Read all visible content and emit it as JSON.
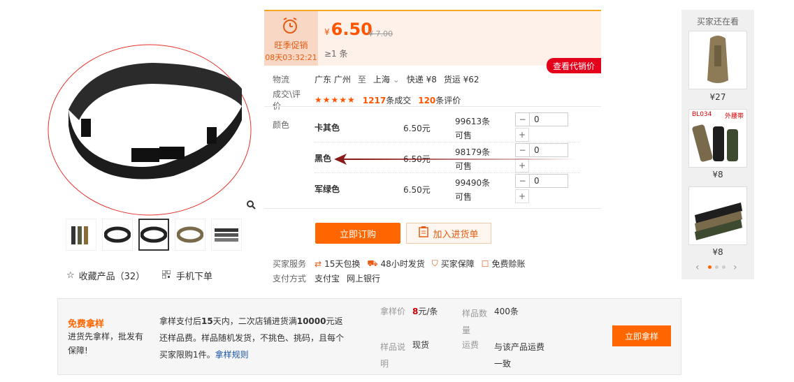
{
  "gallery": {
    "thumbnails": [
      "belt-bundle",
      "belt-black-1",
      "belt-black-2",
      "belt-khaki",
      "belt-set"
    ],
    "favorite_label": "收藏产品（32）",
    "mobile_label": "手机下单"
  },
  "pricebox": {
    "promo_label": "旺季促销",
    "countdown": "08天03:32:21",
    "currency": "¥",
    "price": "6.50",
    "old_price": "¥ 7.00",
    "min_qty": "≥1 条",
    "agent_button": "查看代销价"
  },
  "logistics": {
    "label": "物流",
    "from": "广东 广州",
    "to_word": "至",
    "to": "上海",
    "express": "快递 ¥8",
    "freight": "货运 ¥62"
  },
  "deals": {
    "label": "成交\\评价",
    "stars": "★★★★★",
    "deals_count": "1217",
    "deals_unit": "条成交",
    "reviews_count": "120",
    "reviews_unit": "条评价"
  },
  "colors": {
    "label": "颜色",
    "rows": [
      {
        "name": "卡其色",
        "price": "6.50元",
        "stock": "99613条可售",
        "qty": "0"
      },
      {
        "name": "黑色",
        "price": "6.50元",
        "stock": "98179条可售",
        "qty": "0"
      },
      {
        "name": "军绿色",
        "price": "6.50元",
        "stock": "99490条可售",
        "qty": "0"
      }
    ]
  },
  "actions": {
    "order": "立即订购",
    "cart": "加入进货单"
  },
  "services": {
    "label": "买家服务",
    "items": [
      "15天包换",
      "48小时发货",
      "买家保障",
      "免费赊账"
    ],
    "pay_label": "支付方式",
    "pay_items": [
      "支付宝",
      "网上银行"
    ]
  },
  "sidebar": {
    "title": "买家还在看",
    "items": [
      {
        "price": "¥27",
        "tag": ""
      },
      {
        "price": "¥8",
        "tag": "BL034"
      },
      {
        "price": "¥8",
        "tag": ""
      }
    ],
    "tag_extra": "外腰带"
  },
  "sample": {
    "title": "免费拿样",
    "subtitle": "进货先拿样，批发有保障!",
    "desc_1": "拿样支付后",
    "desc_days": "15",
    "desc_2": "天内，二次店铺进货满",
    "desc_amount": "10000",
    "desc_3": "元返还样品费。样品随机发货，不挑色、挑码，且每个买家限购1件。",
    "rule_link": "拿样规则",
    "price_label": "拿样价",
    "price_value": "8",
    "price_unit": "元/条",
    "qty_label": "样品数量",
    "qty_value": "400条",
    "note_label": "样品说明",
    "note_value": "现货",
    "ship_label": "运费",
    "ship_value": "与该产品运费一致",
    "button": "立即拿样"
  },
  "accent": "#ff5500"
}
